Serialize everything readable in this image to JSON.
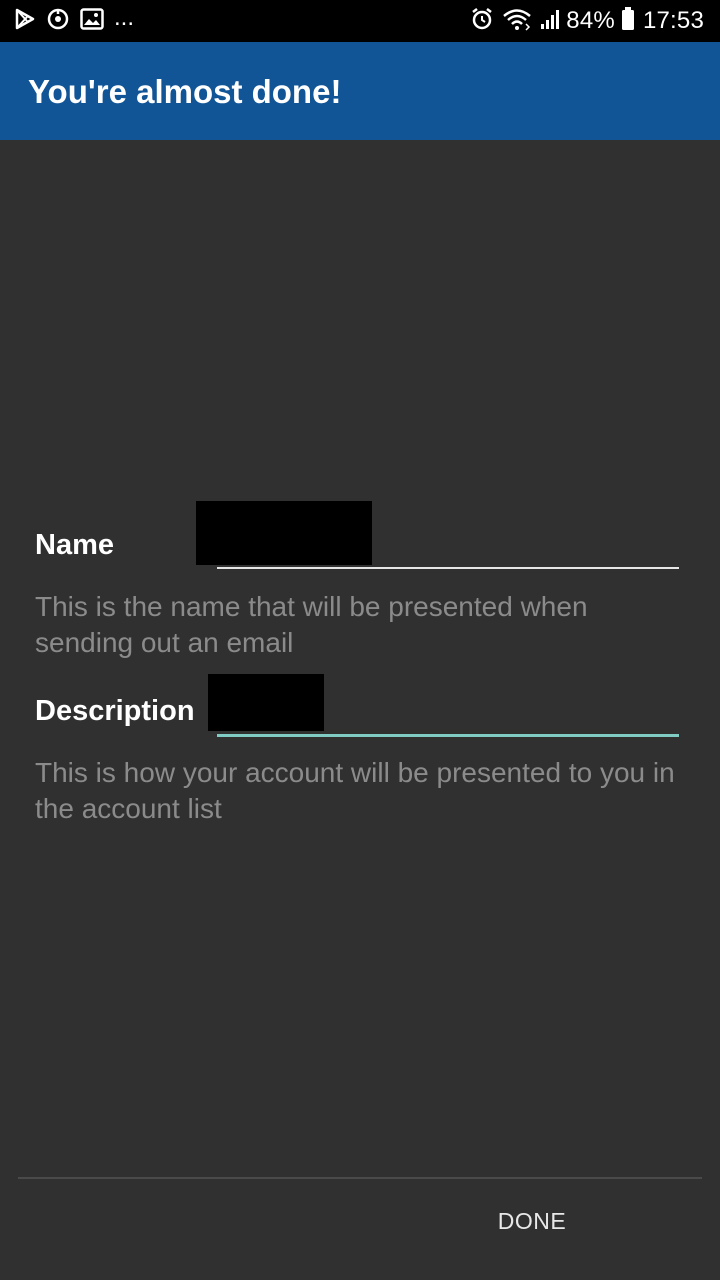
{
  "status_bar": {
    "left_icons": [
      "play-store-icon",
      "sync-icon",
      "gallery-icon"
    ],
    "overflow": "...",
    "right_icons": [
      "alarm-icon",
      "wifi-icon",
      "signal-icon"
    ],
    "battery": "84%",
    "time": "17:53"
  },
  "app_bar": {
    "title": "You're almost done!"
  },
  "form": {
    "name": {
      "label": "Name",
      "helper": "This is the name that will be presented when sending out an email"
    },
    "description": {
      "label": "Description",
      "helper": "This is how your account will be presented to you in the account list"
    }
  },
  "footer": {
    "done_label": "DONE"
  },
  "colors": {
    "app_bar": "#125597",
    "background": "#303030",
    "focus_underline": "#80CBC4",
    "helper_text": "#8B8B8B"
  }
}
